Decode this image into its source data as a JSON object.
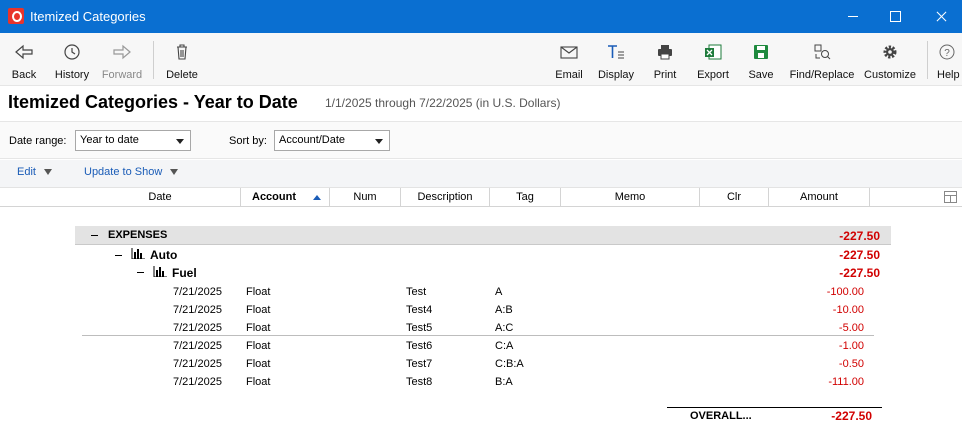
{
  "window": {
    "title": "Itemized Categories"
  },
  "toolbar": {
    "back": "Back",
    "history": "History",
    "forward": "Forward",
    "delete": "Delete",
    "email": "Email",
    "display": "Display",
    "print": "Print",
    "export": "Export",
    "save": "Save",
    "find_replace": "Find/Replace",
    "customize": "Customize",
    "help": "Help"
  },
  "report": {
    "title": "Itemized Categories - Year to Date",
    "subtitle": "1/1/2025 through 7/22/2025 (in U.S. Dollars)"
  },
  "filters": {
    "date_range_label": "Date range:",
    "date_range_value": "Year to date",
    "sort_by_label": "Sort by:",
    "sort_by_value": "Account/Date"
  },
  "actions": {
    "edit": "Edit",
    "update_to_show": "Update to Show"
  },
  "columns": {
    "date": "Date",
    "account": "Account",
    "num": "Num",
    "description": "Description",
    "tag": "Tag",
    "memo": "Memo",
    "clr": "Clr",
    "amount": "Amount"
  },
  "groups": {
    "expenses": {
      "label": "EXPENSES",
      "total": "-227.50"
    },
    "auto": {
      "label": "Auto",
      "total": "-227.50"
    },
    "fuel": {
      "label": "Fuel",
      "total": "-227.50"
    }
  },
  "rows": [
    {
      "date": "7/21/2025",
      "account": "Float",
      "description": "Test",
      "tag": "A",
      "amount": "-100.00"
    },
    {
      "date": "7/21/2025",
      "account": "Float",
      "description": "Test4",
      "tag": "A:B",
      "amount": "-10.00"
    },
    {
      "date": "7/21/2025",
      "account": "Float",
      "description": "Test5",
      "tag": "A:C",
      "amount": "-5.00"
    },
    {
      "date": "7/21/2025",
      "account": "Float",
      "description": "Test6",
      "tag": "C:A",
      "amount": "-1.00"
    },
    {
      "date": "7/21/2025",
      "account": "Float",
      "description": "Test7",
      "tag": "C:B:A",
      "amount": "-0.50"
    },
    {
      "date": "7/21/2025",
      "account": "Float",
      "description": "Test8",
      "tag": "B:A",
      "amount": "-111.00"
    }
  ],
  "overall": {
    "label": "OVERALL...",
    "total": "-227.50"
  },
  "colors": {
    "titlebar": "#0a6fd1",
    "negative": "#d10000",
    "link": "#1a5cb7"
  }
}
